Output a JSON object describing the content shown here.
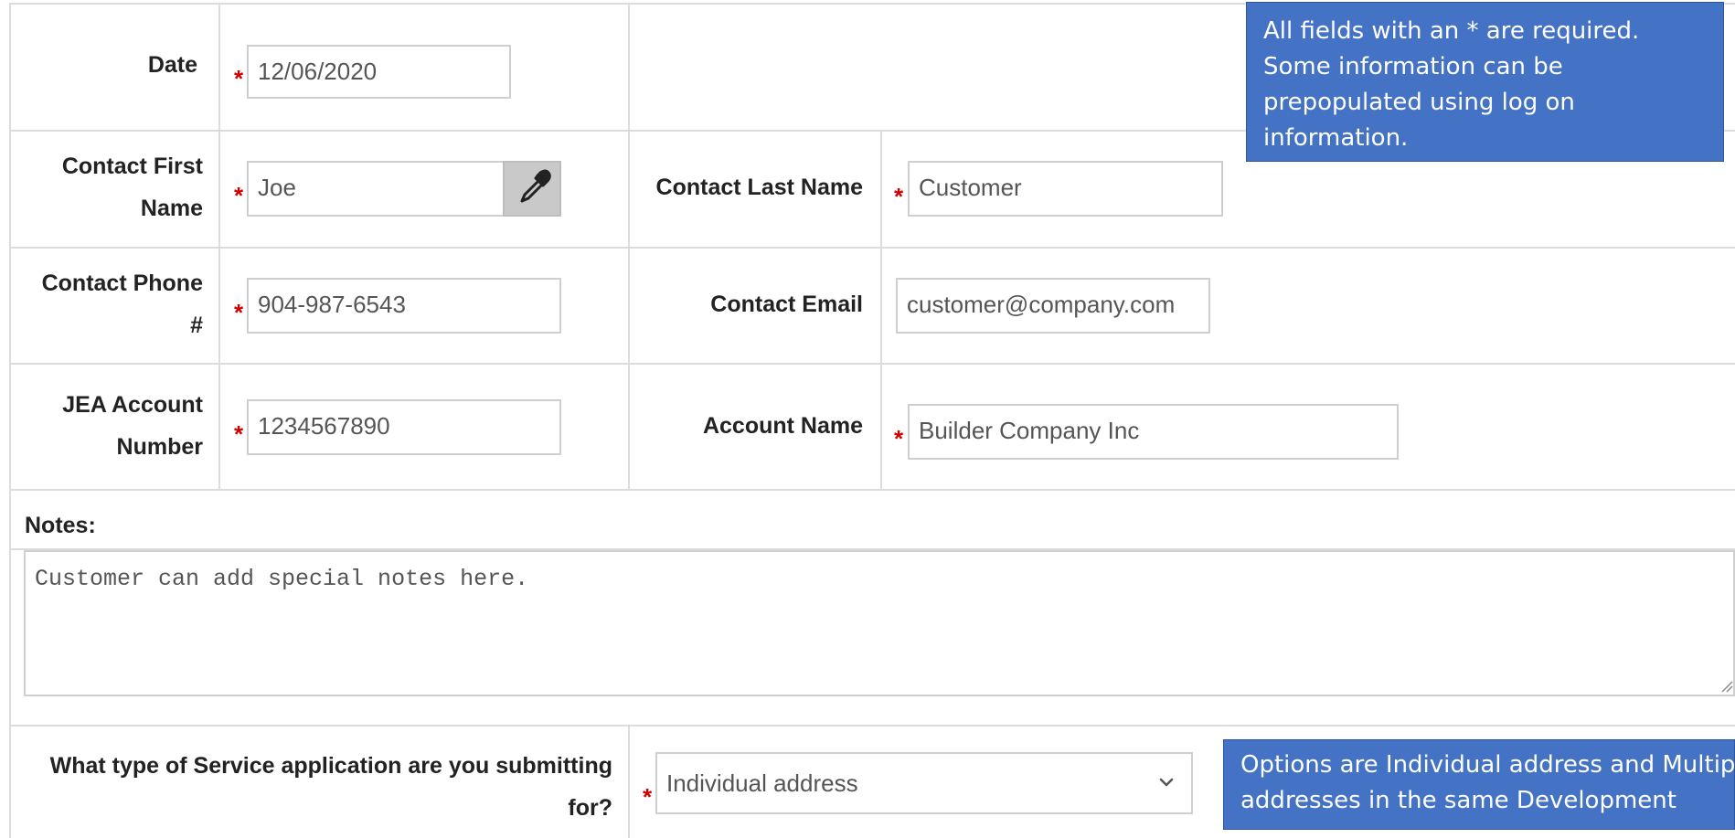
{
  "form": {
    "date": {
      "label": "Date",
      "value": "12/06/2020"
    },
    "first_name": {
      "label_line1": "Contact First",
      "label_line2": "Name",
      "value": "Joe"
    },
    "last_name": {
      "label": "Contact Last Name",
      "value": "Customer"
    },
    "phone": {
      "label_line1": "Contact Phone",
      "label_line2": "#",
      "value": "904-987-6543"
    },
    "email": {
      "label": "Contact Email",
      "value": "customer@company.com"
    },
    "account_number": {
      "label_line1": "JEA Account",
      "label_line2": "Number",
      "value": "1234567890"
    },
    "account_name": {
      "label": "Account Name",
      "value": "Builder Company Inc"
    },
    "notes": {
      "label": "Notes:",
      "value": "Customer can add special notes here."
    },
    "service_type": {
      "label_line1": "What type of Service application are you submitting",
      "label_line2": "for?",
      "selected": "Individual address"
    },
    "required_marker": "*"
  },
  "callouts": {
    "required": "All fields with an * are required. Some information can be prepopulated using log on information.",
    "options": "Options are Individual address and Multiple addresses in the same Development"
  },
  "icons": {
    "eyedropper": "eyedropper-icon",
    "chevron": "chevron-down-icon"
  },
  "colors": {
    "required_star": "#d00000",
    "callout_bg": "#4472c4",
    "border": "#dcdcdc"
  }
}
